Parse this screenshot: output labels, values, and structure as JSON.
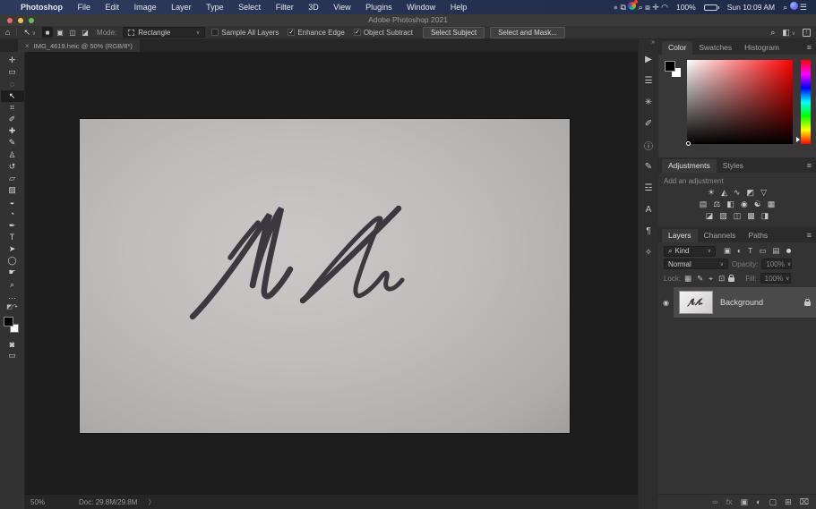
{
  "colors": {
    "accent_red": "#ff0000",
    "menubar_blue": "#273352",
    "panel_bg": "#333333",
    "selected_layer": "#4a4a4a",
    "paper": "#bfbdbb",
    "ink": "#3d3740"
  },
  "menubar": {
    "apple": "",
    "items": [
      {
        "label": "Photoshop",
        "cls": "bold"
      },
      {
        "label": "File"
      },
      {
        "label": "Edit"
      },
      {
        "label": "Image"
      },
      {
        "label": "Layer"
      },
      {
        "label": "Type"
      },
      {
        "label": "Select"
      },
      {
        "label": "Filter"
      },
      {
        "label": "3D"
      },
      {
        "label": "View"
      },
      {
        "label": "Plugins"
      },
      {
        "label": "Window"
      },
      {
        "label": "Help"
      }
    ],
    "status_icons": [
      {
        "name": "hidden-app-icon",
        "glyph": "●",
        "cls": "s-dim"
      },
      {
        "name": "display-icon",
        "glyph": "⧉"
      },
      {
        "name": "media-app-icon",
        "glyph": "",
        "cls": "s-color"
      },
      {
        "name": "zoom-app-icon",
        "glyph": "⌕"
      },
      {
        "name": "screen-mirroring-icon",
        "glyph": "⧈"
      },
      {
        "name": "keyboard-access-icon",
        "glyph": "✛"
      },
      {
        "name": "wifi-icon",
        "glyph": "◠"
      }
    ],
    "battery_pct": "100%",
    "clock": "Sun 10:09 AM",
    "right_icons": [
      {
        "name": "spotlight-icon",
        "glyph": "⌕"
      },
      {
        "name": "siri-icon",
        "glyph": "",
        "cls": "s-siri"
      },
      {
        "name": "control-center-icon",
        "glyph": "☰"
      }
    ]
  },
  "titlebar": {
    "title": "Adobe Photoshop 2021"
  },
  "optionsbar": {
    "mode_buttons": [
      {
        "name": "new-selection-button",
        "glyph": "■",
        "cls": "active"
      },
      {
        "name": "add-selection-button",
        "glyph": "▣"
      },
      {
        "name": "subtract-selection-button",
        "glyph": "◫"
      },
      {
        "name": "intersect-selection-button",
        "glyph": "◪"
      }
    ],
    "mode_label": "Mode:",
    "mode_value": "Rectangle",
    "checkboxes": [
      {
        "name": "sample-all-layers-checkbox",
        "label": "Sample All Layers",
        "cls": ""
      },
      {
        "name": "enhance-edge-checkbox",
        "label": "Enhance Edge",
        "cls": "checked"
      },
      {
        "name": "object-subtract-checkbox",
        "label": "Object Subtract",
        "cls": "checked"
      }
    ],
    "buttons": [
      {
        "name": "select-subject-button",
        "label": "Select Subject"
      },
      {
        "name": "select-and-mask-button",
        "label": "Select and Mask..."
      }
    ]
  },
  "tab": {
    "close": "×",
    "label": "IMG_4619.heic @ 50% (RGB/8*)"
  },
  "tools": [
    {
      "name": "move-tool",
      "glyph": "✛"
    },
    {
      "name": "marquee-tool",
      "glyph": "▭"
    },
    {
      "name": "lasso-tool",
      "glyph": "◌"
    },
    {
      "name": "object-selection-tool",
      "glyph": "↖",
      "cls": "active"
    },
    {
      "name": "crop-tool",
      "glyph": "⌗"
    },
    {
      "name": "eyedropper-tool",
      "glyph": "✐"
    },
    {
      "name": "healing-brush-tool",
      "glyph": "✚"
    },
    {
      "name": "brush-tool",
      "glyph": "✎"
    },
    {
      "name": "clone-stamp-tool",
      "glyph": "♙"
    },
    {
      "name": "history-brush-tool",
      "glyph": "↺"
    },
    {
      "name": "eraser-tool",
      "glyph": "▱"
    },
    {
      "name": "gradient-tool",
      "glyph": "▨"
    },
    {
      "name": "blur-tool",
      "glyph": "◒"
    },
    {
      "name": "dodge-tool",
      "glyph": "◔"
    },
    {
      "name": "pen-tool",
      "glyph": "✒"
    },
    {
      "name": "type-tool",
      "glyph": "T"
    },
    {
      "name": "path-selection-tool",
      "glyph": "➤"
    },
    {
      "name": "shape-tool",
      "glyph": "◯"
    },
    {
      "name": "hand-tool",
      "glyph": "☛"
    },
    {
      "name": "zoom-tool",
      "glyph": "⌕"
    },
    {
      "name": "edit-toolbar-button",
      "glyph": "…"
    }
  ],
  "toolbar_bottom": [
    {
      "name": "quick-mask-button",
      "glyph": "◙"
    },
    {
      "name": "screen-mode-button",
      "glyph": "▭"
    }
  ],
  "dock_icons": [
    {
      "name": "actions-panel-icon",
      "glyph": "▶"
    },
    {
      "name": "properties-panel-icon",
      "glyph": "☰"
    },
    {
      "name": "brush-settings-panel-icon",
      "glyph": "✳"
    },
    {
      "name": "brushes-panel-icon",
      "glyph": "✐"
    },
    {
      "name": "info-panel-icon",
      "glyph": "ⓘ"
    },
    {
      "name": "notes-panel-icon",
      "glyph": "✎"
    },
    {
      "name": "tool-presets-panel-icon",
      "glyph": "☲"
    },
    {
      "name": "character-panel-icon",
      "glyph": "A"
    },
    {
      "name": "paragraph-panel-icon",
      "glyph": "¶"
    },
    {
      "name": "clone-source-panel-icon",
      "glyph": "✧"
    }
  ],
  "color_panel": {
    "tabs": [
      {
        "name": "tab-color",
        "label": "Color",
        "cls": "active"
      },
      {
        "name": "tab-swatches",
        "label": "Swatches"
      },
      {
        "name": "tab-histogram",
        "label": "Histogram"
      }
    ]
  },
  "adjustments_panel": {
    "tabs": [
      {
        "name": "tab-adjustments",
        "label": "Adjustments",
        "cls": "active"
      },
      {
        "name": "tab-styles",
        "label": "Styles"
      }
    ],
    "hint": "Add an adjustment",
    "row1": [
      {
        "name": "brightness-contrast-icon",
        "glyph": "☀"
      },
      {
        "name": "levels-icon",
        "glyph": "◭"
      },
      {
        "name": "curves-icon",
        "glyph": "∿"
      },
      {
        "name": "exposure-icon",
        "glyph": "◩"
      },
      {
        "name": "vibrance-icon",
        "glyph": "▽"
      }
    ],
    "row2": [
      {
        "name": "hue-saturation-icon",
        "glyph": "▤"
      },
      {
        "name": "color-balance-icon",
        "glyph": "⚖"
      },
      {
        "name": "black-white-icon",
        "glyph": "◧"
      },
      {
        "name": "photo-filter-icon",
        "glyph": "◉"
      },
      {
        "name": "channel-mixer-icon",
        "glyph": "☯"
      },
      {
        "name": "color-lookup-icon",
        "glyph": "▦"
      }
    ],
    "row3": [
      {
        "name": "invert-icon",
        "glyph": "◪"
      },
      {
        "name": "posterize-icon",
        "glyph": "▨"
      },
      {
        "name": "threshold-icon",
        "glyph": "◫"
      },
      {
        "name": "gradient-map-icon",
        "glyph": "▩"
      },
      {
        "name": "selective-color-icon",
        "glyph": "◨"
      }
    ]
  },
  "layers_panel": {
    "tabs": [
      {
        "name": "tab-layers",
        "label": "Layers",
        "cls": "active"
      },
      {
        "name": "tab-channels",
        "label": "Channels"
      },
      {
        "name": "tab-paths",
        "label": "Paths"
      }
    ],
    "filter_search": "⌕",
    "filter_value": "Kind",
    "filter_icons": [
      {
        "name": "filter-pixel-layers-icon",
        "glyph": "▣"
      },
      {
        "name": "filter-adjustment-layers-icon",
        "glyph": "◐"
      },
      {
        "name": "filter-type-layers-icon",
        "glyph": "T"
      },
      {
        "name": "filter-shape-layers-icon",
        "glyph": "▭"
      },
      {
        "name": "filter-smart-objects-icon",
        "glyph": "▤"
      }
    ],
    "blend_mode": "Normal",
    "opacity_label": "Opacity:",
    "opacity_value": "100%",
    "lock_label": "Lock:",
    "lock_icons": [
      {
        "name": "lock-transparent-icon",
        "glyph": "▦"
      },
      {
        "name": "lock-pixels-icon",
        "glyph": "✎"
      },
      {
        "name": "lock-position-icon",
        "glyph": "⌖"
      },
      {
        "name": "lock-artboard-icon",
        "glyph": "⊡"
      }
    ],
    "fill_label": "Fill:",
    "fill_value": "100%",
    "layer": {
      "eye": "◉",
      "name": "Background"
    },
    "bottom_icons": [
      {
        "name": "link-layers-icon",
        "glyph": "∞",
        "cls": "dim"
      },
      {
        "name": "layer-effects-icon",
        "glyph": "fx",
        "cls": "dim"
      },
      {
        "name": "layer-mask-icon",
        "glyph": "▣"
      },
      {
        "name": "new-adjustment-layer-icon",
        "glyph": "◐"
      },
      {
        "name": "new-group-icon",
        "glyph": "▢"
      },
      {
        "name": "new-layer-icon",
        "glyph": "⊞"
      },
      {
        "name": "delete-layer-icon",
        "glyph": "⌧"
      }
    ]
  },
  "statusbar": {
    "zoom": "50%",
    "doc": "Doc: 29.8M/29.8M",
    "chevron": "〉"
  }
}
